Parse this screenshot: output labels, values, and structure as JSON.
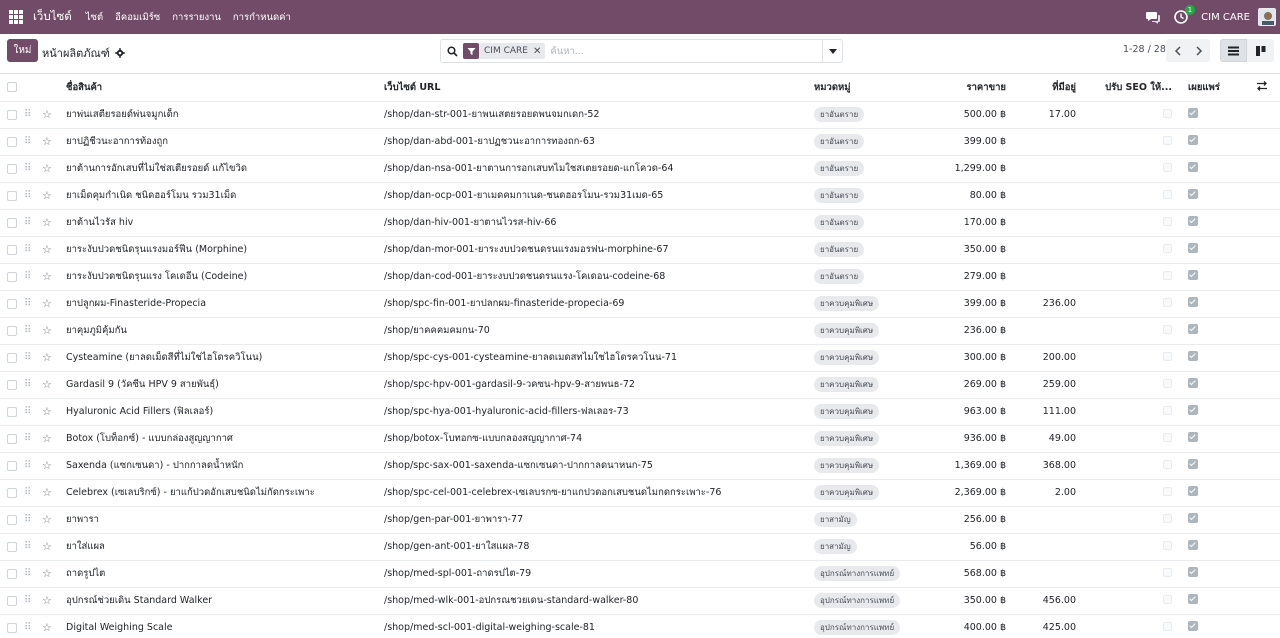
{
  "navbar": {
    "brand": "เว็บไซต์",
    "menu": [
      "ไซต์",
      "อีคอมเมิร์ซ",
      "การรายงาน",
      "การกำหนดค่า"
    ],
    "activity_count": "1",
    "company": "CIM CARE"
  },
  "control": {
    "new_label": "ใหม่",
    "title": "หน้าผลิตภัณฑ์",
    "facet_value": "CIM CARE",
    "search_placeholder": "ค้นหา...",
    "pager": "1-28 / 28"
  },
  "table": {
    "headers": {
      "name": "ชื่อสินค้า",
      "url": "เว็บไซต์ URL",
      "category": "หมวดหมู่",
      "price": "ราคาขาย",
      "stock": "ที่มีอยู่",
      "seo": "ปรับ SEO ให้...",
      "published": "เผยแพร่"
    },
    "rows": [
      {
        "name": "ยาพ่นเสตียรอยด์พ่นจมูกเด็ก",
        "url": "/shop/dan-str-001-ยาพนเสตยรอยดพนจมกเดก-52",
        "category": "ยาอันตราย",
        "price": "500.00 ฿",
        "stock": "17.00"
      },
      {
        "name": "ยาปฏิชีวนะอาการท้องถูก",
        "url": "/shop/dan-abd-001-ยาปฏชวนะอาการทองถก-63",
        "category": "ยาอันตราย",
        "price": "399.00 ฿",
        "stock": ""
      },
      {
        "name": "ยาต้านการอักเสบที่ไม่ใช่สเตียรอยด์ แก้ไขวิด",
        "url": "/shop/dan-nsa-001-ยาตานการอกเสบทไมใชสเตยรอยด-แกโควด-64",
        "category": "ยาอันตราย",
        "price": "1,299.00 ฿",
        "stock": ""
      },
      {
        "name": "ยาเม็ดคุมกำเนิด ชนิดฮอร์โมน รวม31เม็ด",
        "url": "/shop/dan-ocp-001-ยาเมดคมกาเนด-ชนดฮอรโมน-รวม31เมด-65",
        "category": "ยาอันตราย",
        "price": "80.00 ฿",
        "stock": ""
      },
      {
        "name": "ยาต้านไวรัส hiv",
        "url": "/shop/dan-hiv-001-ยาตานไวรส-hiv-66",
        "category": "ยาอันตราย",
        "price": "170.00 ฿",
        "stock": ""
      },
      {
        "name": "ยาระงับปวดชนิดรุนแรงมอร์ฟีน (Morphine)",
        "url": "/shop/dan-mor-001-ยาระงบปวดชนดรนแรงมอรฟน-morphine-67",
        "category": "ยาอันตราย",
        "price": "350.00 ฿",
        "stock": ""
      },
      {
        "name": "ยาระงับปวดชนิดรุนแรง โคเดอีน (Codeine)",
        "url": "/shop/dan-cod-001-ยาระงบปวดชนดรนแรง-โคเดอน-codeine-68",
        "category": "ยาอันตราย",
        "price": "279.00 ฿",
        "stock": ""
      },
      {
        "name": "ยาปลูกผม-Finasteride-Propecia",
        "url": "/shop/spc-fin-001-ยาปลกผม-finasteride-propecia-69",
        "category": "ยาควบคุมพิเศษ",
        "price": "399.00 ฿",
        "stock": "236.00"
      },
      {
        "name": "ยาคุมภูมิคุ้มกัน",
        "url": "/shop/ยาคคคมคมกน-70",
        "category": "ยาควบคุมพิเศษ",
        "price": "236.00 ฿",
        "stock": ""
      },
      {
        "name": "Cysteamine (ยาลดเม็ดสีที่ไม่ใช่ไฮโดรควิโนน)",
        "url": "/shop/spc-cys-001-cysteamine-ยาลดเมดสทไมใชไฮโดรควโนน-71",
        "category": "ยาควบคุมพิเศษ",
        "price": "300.00 ฿",
        "stock": "200.00"
      },
      {
        "name": "Gardasil 9 (วัคซีน HPV 9 สายพันธุ์)",
        "url": "/shop/spc-hpv-001-gardasil-9-วคซน-hpv-9-สายพนธ-72",
        "category": "ยาควบคุมพิเศษ",
        "price": "269.00 ฿",
        "stock": "259.00"
      },
      {
        "name": "Hyaluronic Acid Fillers (ฟิลเลอร์)",
        "url": "/shop/spc-hya-001-hyaluronic-acid-fillers-ฟลเลอร-73",
        "category": "ยาควบคุมพิเศษ",
        "price": "963.00 ฿",
        "stock": "111.00"
      },
      {
        "name": "Botox (โบท็อกซ์) - แบบกล่องสูญญากาศ",
        "url": "/shop/botox-โบทอกซ-แบบกลองสญญากาศ-74",
        "category": "ยาควบคุมพิเศษ",
        "price": "936.00 ฿",
        "stock": "49.00"
      },
      {
        "name": "Saxenda (แซกเซนดา) - ปากกาลดน้ำหนัก",
        "url": "/shop/spc-sax-001-saxenda-แซกเซนดา-ปากกาลดนาหนก-75",
        "category": "ยาควบคุมพิเศษ",
        "price": "1,369.00 ฿",
        "stock": "368.00"
      },
      {
        "name": "Celebrex (เซเลบริกซ์) - ยาแก้ปวดอักเสบชนิดไม่กัดกระเพาะ",
        "url": "/shop/spc-cel-001-celebrex-เซเลบรกซ-ยาแกปวดอกเสบชนดไมกดกระเพาะ-76",
        "category": "ยาควบคุมพิเศษ",
        "price": "2,369.00 ฿",
        "stock": "2.00"
      },
      {
        "name": "ยาพารา",
        "url": "/shop/gen-par-001-ยาพารา-77",
        "category": "ยาสามัญ",
        "price": "256.00 ฿",
        "stock": ""
      },
      {
        "name": "ยาใส่แผล",
        "url": "/shop/gen-ant-001-ยาใสแผล-78",
        "category": "ยาสามัญ",
        "price": "56.00 ฿",
        "stock": ""
      },
      {
        "name": "ถาดรูปไต",
        "url": "/shop/med-spl-001-ถาดรปไต-79",
        "category": "อุปกรณ์ทางการแพทย์",
        "price": "568.00 ฿",
        "stock": ""
      },
      {
        "name": "อุปกรณ์ช่วยเดิน Standard Walker",
        "url": "/shop/med-wlk-001-อปกรณชวยเดน-standard-walker-80",
        "category": "อุปกรณ์ทางการแพทย์",
        "price": "350.00 ฿",
        "stock": "456.00"
      },
      {
        "name": "Digital Weighing Scale",
        "url": "/shop/med-scl-001-digital-weighing-scale-81",
        "category": "อุปกรณ์ทางการแพทย์",
        "price": "400.00 ฿",
        "stock": "425.00"
      }
    ]
  },
  "colors": {
    "brand": "#714b67",
    "badge_bg": "#e7e9ed",
    "border": "#dee2e6"
  },
  "icons": [
    "apps-grid-icon",
    "chat-icon",
    "activity-clock-icon",
    "gear-icon",
    "search-icon",
    "filter-icon",
    "close-icon",
    "caret-down-icon",
    "chevron-left-icon",
    "chevron-right-icon",
    "list-view-icon",
    "kanban-view-icon",
    "drag-handle-icon",
    "star-icon",
    "optional-columns-icon"
  ]
}
